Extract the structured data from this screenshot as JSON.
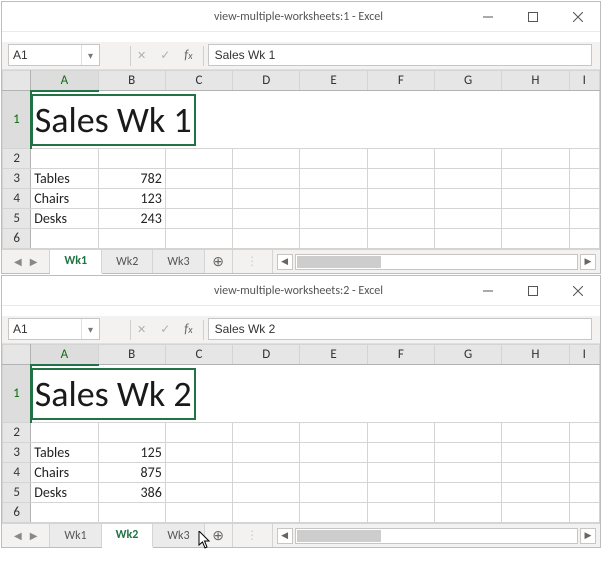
{
  "columns": [
    "A",
    "B",
    "C",
    "D",
    "E",
    "F",
    "G",
    "H",
    "I"
  ],
  "rows": [
    "1",
    "2",
    "3",
    "4",
    "5",
    "6"
  ],
  "windows": [
    {
      "title": "view-multiple-worksheets:1 - Excel",
      "namebox": "A1",
      "formula": "Sales Wk 1",
      "big_title": "Sales Wk 1",
      "data_rows": [
        {
          "a": "Tables",
          "b": "782"
        },
        {
          "a": "Chairs",
          "b": "123"
        },
        {
          "a": "Desks",
          "b": "243"
        }
      ],
      "tabs": [
        {
          "label": "Wk1",
          "active": true
        },
        {
          "label": "Wk2",
          "active": false
        },
        {
          "label": "Wk3",
          "active": false
        }
      ]
    },
    {
      "title": "view-multiple-worksheets:2 - Excel",
      "namebox": "A1",
      "formula": "Sales Wk 2",
      "big_title": "Sales Wk 2",
      "data_rows": [
        {
          "a": "Tables",
          "b": "125"
        },
        {
          "a": "Chairs",
          "b": "875"
        },
        {
          "a": "Desks",
          "b": "386"
        }
      ],
      "tabs": [
        {
          "label": "Wk1",
          "active": false
        },
        {
          "label": "Wk2",
          "active": true
        },
        {
          "label": "Wk3",
          "active": false
        }
      ]
    }
  ]
}
